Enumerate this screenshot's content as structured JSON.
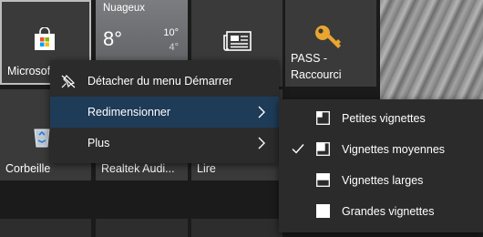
{
  "tiles": {
    "store": {
      "label": "Microsoft Store",
      "icon": "store-bag-icon"
    },
    "weather": {
      "city": "Nuageux",
      "temp": "8°",
      "high": "10°",
      "low": "4°"
    },
    "news": {
      "icon": "news-icon"
    },
    "pass": {
      "label_line1": "PASS -",
      "label_line2": "Raccourci",
      "icon": "key-icon"
    },
    "recycle": {
      "label": "Corbeille",
      "icon": "recycle-bin-icon"
    },
    "realtek": {
      "label": "Realtek Audi..."
    },
    "lire": {
      "label": "Lire"
    }
  },
  "context_menu": {
    "items": [
      {
        "label": "Détacher du menu Démarrer",
        "icon": "unpin-icon"
      },
      {
        "label": "Redimensionner",
        "has_submenu": true,
        "highlighted": true
      },
      {
        "label": "Plus",
        "has_submenu": true
      }
    ]
  },
  "submenu": {
    "items": [
      {
        "label": "Petites vignettes",
        "checked": false
      },
      {
        "label": "Vignettes moyennes",
        "checked": true
      },
      {
        "label": "Vignettes larges",
        "checked": false
      },
      {
        "label": "Grandes vignettes",
        "checked": false
      }
    ]
  },
  "colors": {
    "highlight": "#1e3b57",
    "menu_bg": "#2b2b2b",
    "tile_bg": "#3a3a3a",
    "key": "#e8a530"
  }
}
